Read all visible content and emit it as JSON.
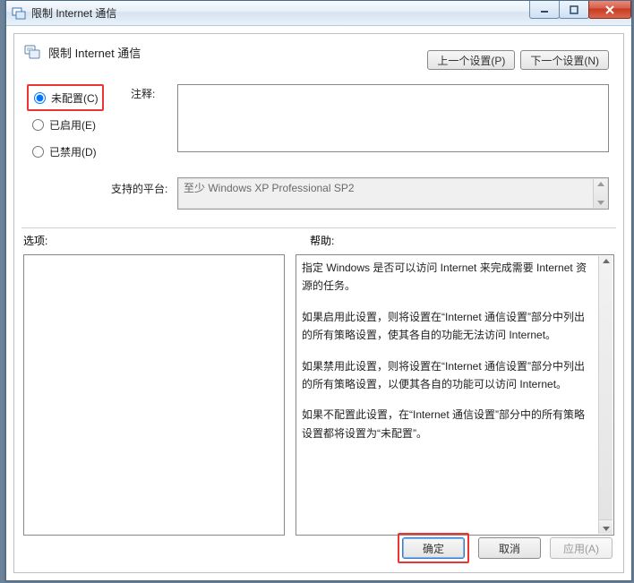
{
  "titlebar": {
    "title": "限制 Internet 通信"
  },
  "header": {
    "title": "限制 Internet 通信"
  },
  "nav": {
    "prev": "上一个设置(P)",
    "next": "下一个设置(N)"
  },
  "radios": {
    "not_configured": "未配置(C)",
    "enabled": "已启用(E)",
    "disabled": "已禁用(D)"
  },
  "labels": {
    "comment": "注释:",
    "platform": "支持的平台:",
    "options": "选项:",
    "help": "帮助:"
  },
  "platform_text": "至少 Windows XP Professional SP2",
  "help_text": {
    "p1": "指定 Windows 是否可以访问 Internet 来完成需要 Internet 资源的任务。",
    "p2": "如果启用此设置，则将设置在“Internet 通信设置”部分中列出的所有策略设置，使其各自的功能无法访问 Internet。",
    "p3": "如果禁用此设置，则将设置在“Internet 通信设置”部分中列出的所有策略设置，以便其各自的功能可以访问 Internet。",
    "p4": "如果不配置此设置，在“Internet 通信设置”部分中的所有策略设置都将设置为“未配置”。"
  },
  "footer": {
    "ok": "确定",
    "cancel": "取消",
    "apply": "应用(A)"
  }
}
